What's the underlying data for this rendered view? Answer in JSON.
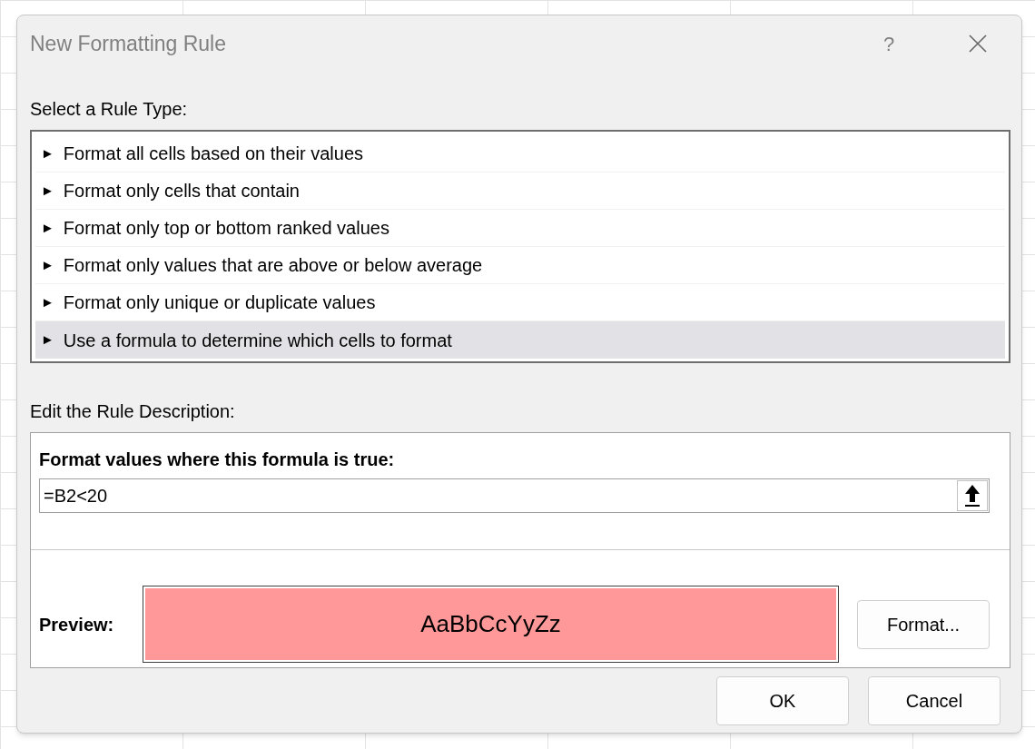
{
  "window": {
    "title": "New Formatting Rule",
    "help": "?"
  },
  "rule_type": {
    "label": "Select a Rule Type:",
    "items": [
      {
        "bullet": "►",
        "label": "Format all cells based on their values",
        "selected": false
      },
      {
        "bullet": "►",
        "label": "Format only cells that contain",
        "selected": false
      },
      {
        "bullet": "►",
        "label": "Format only top or bottom ranked values",
        "selected": false
      },
      {
        "bullet": "►",
        "label": "Format only values that are above or below average",
        "selected": false
      },
      {
        "bullet": "►",
        "label": "Format only unique or duplicate values",
        "selected": false
      },
      {
        "bullet": "►",
        "label": "Use a formula to determine which cells to format",
        "selected": true
      }
    ]
  },
  "description": {
    "label": "Edit the Rule Description:",
    "formula_label": "Format values where this formula is true:",
    "formula": {
      "value": "=B2<20"
    },
    "preview": {
      "label": "Preview:",
      "sample": "AaBbCcYyZz",
      "color": "#ff9999"
    },
    "format_button": "Format..."
  },
  "buttons": [
    "OK",
    "Cancel"
  ]
}
